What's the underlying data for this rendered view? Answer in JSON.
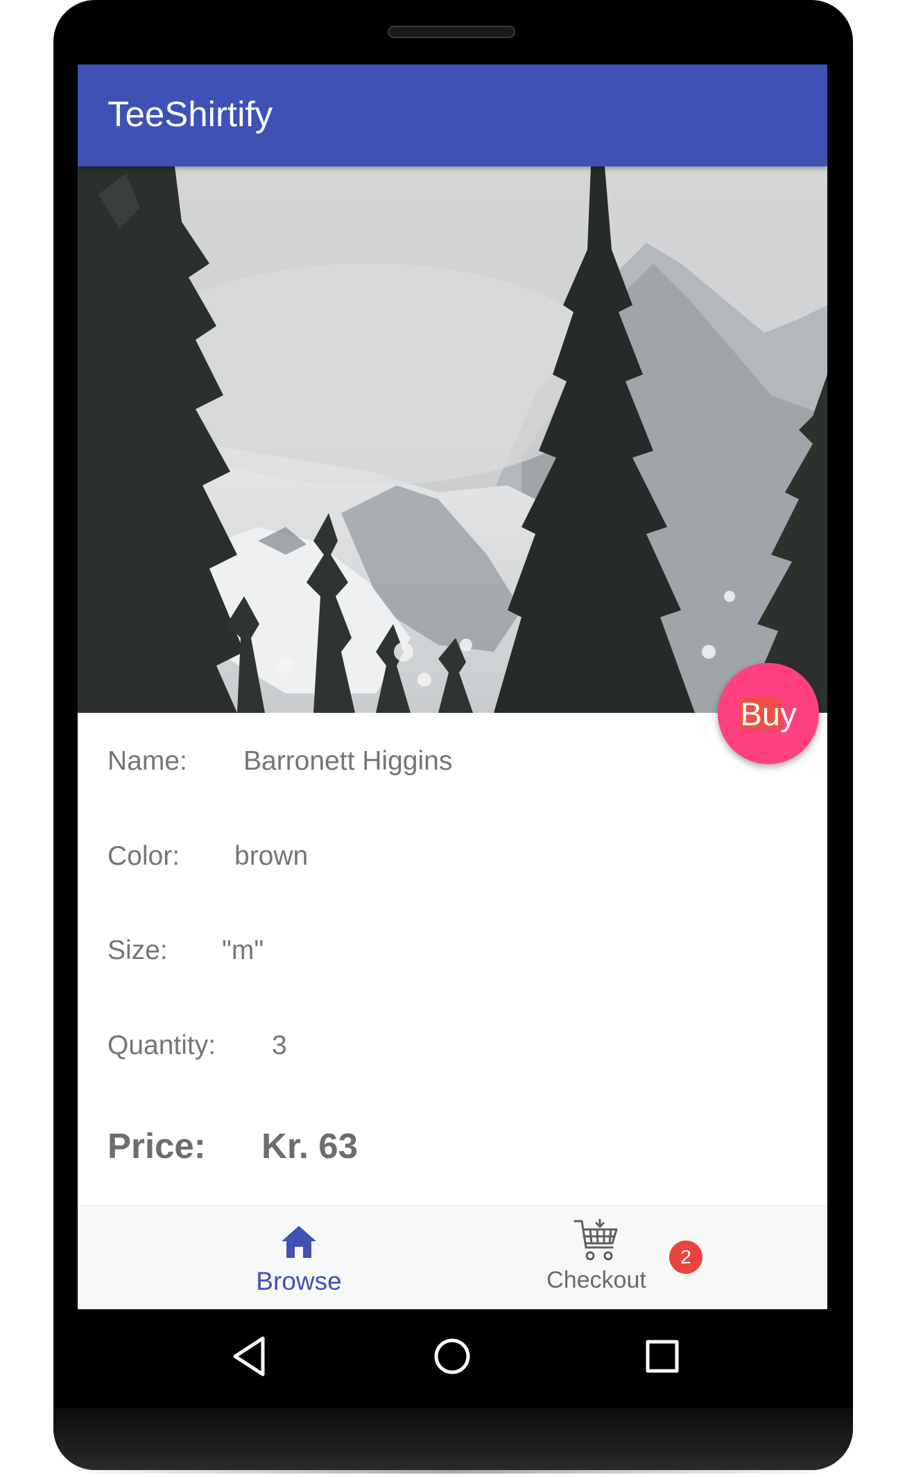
{
  "app": {
    "title": "TeeShirtify",
    "accent_color": "#3f51b5",
    "fab_color": "#ff4081"
  },
  "product_image": {
    "subject_icon": "snowy-mountain-forest-photo"
  },
  "buy_button": {
    "label": "Buy"
  },
  "details": {
    "name_label": "Name:",
    "name_value": "Barronett Higgins",
    "color_label": "Color:",
    "color_value": "brown",
    "size_label": "Size:",
    "size_value": "\"m\"",
    "quantity_label": "Quantity:",
    "quantity_value": "3",
    "price_label": "Price:",
    "price_value": "Kr. 63"
  },
  "bottom_nav": {
    "items": [
      {
        "label": "Browse",
        "icon": "home-icon",
        "active": true
      },
      {
        "label": "Checkout",
        "icon": "shopping-cart-icon",
        "active": false,
        "badge": "2"
      }
    ]
  },
  "system_nav": {
    "back_icon": "back-triangle-icon",
    "home_icon": "home-circle-icon",
    "recents_icon": "recents-square-icon"
  }
}
